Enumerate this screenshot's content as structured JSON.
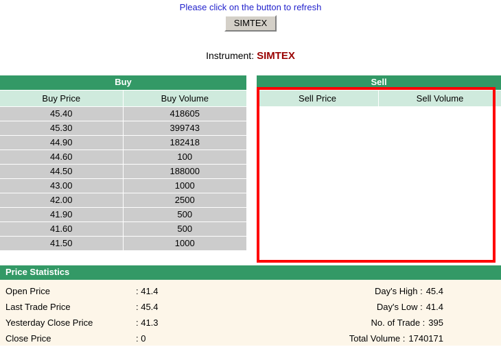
{
  "refresh": {
    "message": "Please click on the button to refresh",
    "button_label": "SIMTEX"
  },
  "instrument": {
    "label": "Instrument:",
    "value": "SIMTEX",
    "value_color": "#990000"
  },
  "order_book": {
    "buy": {
      "title": "Buy",
      "columns": [
        "Buy Price",
        "Buy Volume"
      ],
      "rows": [
        [
          "45.40",
          "418605"
        ],
        [
          "45.30",
          "399743"
        ],
        [
          "44.90",
          "182418"
        ],
        [
          "44.60",
          "100"
        ],
        [
          "44.50",
          "188000"
        ],
        [
          "43.00",
          "1000"
        ],
        [
          "42.00",
          "2500"
        ],
        [
          "41.90",
          "500"
        ],
        [
          "41.60",
          "500"
        ],
        [
          "41.50",
          "1000"
        ]
      ]
    },
    "sell": {
      "title": "Sell",
      "columns": [
        "Sell Price",
        "Sell Volume"
      ],
      "rows": []
    },
    "highlight_color": "#ff0000",
    "header_color": "#339966",
    "subheader_color": "#cfeadd",
    "row_color": "#cccccc"
  },
  "price_statistics": {
    "title": "Price Statistics",
    "panel_color": "#fdf6e9",
    "left": [
      {
        "label": "Open Price",
        "value": ": 41.4"
      },
      {
        "label": "Last Trade Price",
        "value": ": 45.4"
      },
      {
        "label": "Yesterday Close Price",
        "value": ": 41.3"
      },
      {
        "label": "Close Price",
        "value": ": 0"
      }
    ],
    "right": [
      {
        "label": "Day's High :",
        "value": "45.4"
      },
      {
        "label": "Day's Low :",
        "value": "41.4"
      },
      {
        "label": "No. of Trade :",
        "value": "395"
      },
      {
        "label": "Total Volume :",
        "value": "1740171"
      }
    ]
  }
}
